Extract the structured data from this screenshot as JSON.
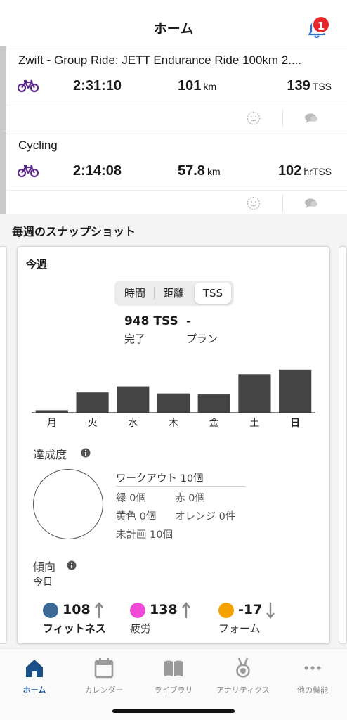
{
  "header": {
    "title": "ホーム",
    "notification_count": "1"
  },
  "activities": [
    {
      "title": "Zwift - Group Ride: JETT Endurance Ride 100km 2....",
      "time": "2:31:10",
      "distance": "101",
      "distance_unit": "km",
      "tss": "139",
      "tss_unit": "TSS"
    },
    {
      "title": "Cycling",
      "time": "2:14:08",
      "distance": "57.8",
      "distance_unit": "km",
      "tss": "102",
      "tss_unit": "hrTSS"
    }
  ],
  "snapshot": {
    "section_title": "毎週のスナップショット",
    "week_title": "今週",
    "segments": [
      "時間",
      "距離",
      "TSS"
    ],
    "selected_segment": "TSS",
    "completed_value": "948 TSS",
    "plan_value": "-",
    "completed_label": "完了",
    "plan_label": "プラン",
    "chart_data": {
      "type": "bar",
      "categories": [
        "月",
        "火",
        "水",
        "木",
        "金",
        "土",
        "日"
      ],
      "values": [
        5,
        40,
        52,
        38,
        36,
        76,
        85
      ],
      "ylim": [
        0,
        100
      ],
      "highlighted_category": "日",
      "bar_color": "#444444"
    },
    "achievement": {
      "title": "達成度",
      "workouts_total": "ワークアウト 10個",
      "green": "緑 0個",
      "red": "赤 0個",
      "yellow": "黄色 0個",
      "orange": "オレンジ 0件",
      "unplanned": "未計画 10個"
    },
    "trend": {
      "title": "傾向",
      "period": "今日",
      "metrics": [
        {
          "value": "108",
          "label": "フィットネス",
          "color": "#3b6a96",
          "direction": "up"
        },
        {
          "value": "138",
          "label": "疲労",
          "color": "#f04ad7",
          "direction": "up"
        },
        {
          "value": "-17",
          "label": "フォーム",
          "color": "#f5a200",
          "direction": "down"
        }
      ]
    }
  },
  "tabs": [
    {
      "label": "ホーム",
      "icon": "home-icon",
      "active": true
    },
    {
      "label": "カレンダー",
      "icon": "calendar-icon",
      "active": false
    },
    {
      "label": "ライブラリ",
      "icon": "library-icon",
      "active": false
    },
    {
      "label": "アナリティクス",
      "icon": "medal-icon",
      "active": false
    },
    {
      "label": "他の機能",
      "icon": "more-icon",
      "active": false
    }
  ],
  "colors": {
    "accent": "#1a4f8a",
    "bike_icon": "#5b2a86",
    "badge": "#e8262a",
    "bell": "#2a6fd6"
  }
}
